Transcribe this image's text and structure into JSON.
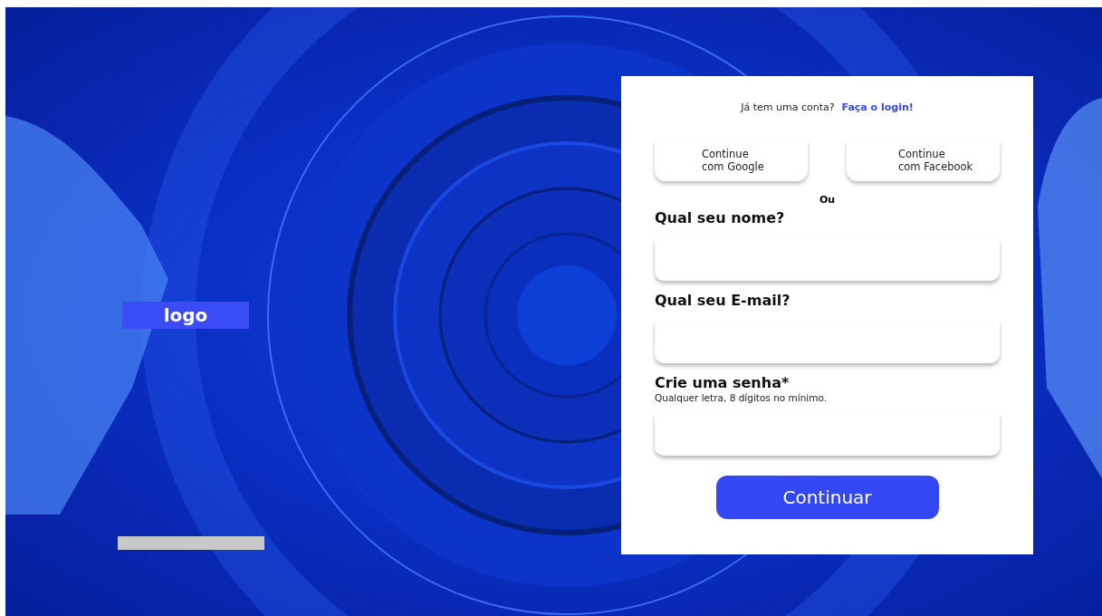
{
  "logo": {
    "label": "logo"
  },
  "form": {
    "login_prompt": "Já tem uma conta?",
    "login_link": "Faça o login!",
    "social_buttons": [
      {
        "lines": [
          "Continue",
          "com Google"
        ]
      },
      {
        "lines": [
          "Continue",
          "com Facebook"
        ]
      }
    ],
    "separator": "Ou",
    "fields": [
      {
        "label": "Qual seu nome?"
      },
      {
        "label": "Qual seu E-mail?"
      },
      {
        "label": "Crie uma senha*",
        "hint": "Qualquer letra, 8 dígitos no mínimo."
      }
    ],
    "submit": "Continuar"
  }
}
